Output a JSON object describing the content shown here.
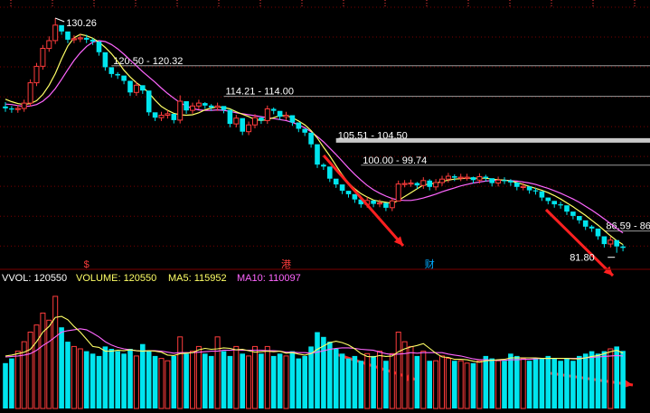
{
  "colors": {
    "background": "#000000",
    "up": "#ff3c3c",
    "down": "#00e5ee",
    "ma5": "#ffff66",
    "ma10": "#ff66ff",
    "grid": "#7a0000",
    "level": "#ffffff",
    "arrow": "#ff2020",
    "label": "#ffffff"
  },
  "chart_data": [
    {
      "type": "candlestick",
      "title": "",
      "ylim": [
        79.5,
        132.5
      ],
      "grid": true,
      "annotations": {
        "high_label": "130.26",
        "low_label": "81.80",
        "levels": [
          {
            "label": "120.50 - 120.32",
            "value": 120.4
          },
          {
            "label": "114.21 - 114.00",
            "value": 114.1
          },
          {
            "label": "105.51 - 104.50",
            "value": 105.0
          },
          {
            "label": "100.00 - 99.74",
            "value": 99.87
          },
          {
            "label": "86.59 - 86",
            "value": 86.3
          }
        ],
        "markers": [
          "$",
          "港",
          "财"
        ],
        "arrows": 2
      },
      "x": [
        1,
        2,
        3,
        4,
        5,
        6,
        7,
        8,
        9,
        10,
        11,
        12,
        13,
        14,
        15,
        16,
        17,
        18,
        19,
        20,
        21,
        22,
        23,
        24,
        25,
        26,
        27,
        28,
        29,
        30,
        31,
        32,
        33,
        34,
        35,
        36,
        37,
        38,
        39,
        40,
        41,
        42,
        43,
        44,
        45,
        46,
        47,
        48,
        49,
        50,
        51,
        52,
        53,
        54,
        55,
        56,
        57,
        58,
        59,
        60,
        61,
        62,
        63,
        64,
        65,
        66,
        67,
        68,
        69,
        70,
        71,
        72,
        73,
        74,
        75,
        76,
        77,
        78,
        79,
        80,
        81,
        82,
        83,
        84,
        85,
        86,
        87,
        88,
        89,
        90,
        91,
        92,
        93,
        94,
        95,
        96,
        97,
        98,
        99,
        100
      ],
      "open": [
        112.0,
        111.6,
        111.4,
        111.6,
        112.7,
        116.9,
        120.3,
        124.0,
        125.6,
        128.8,
        127.5,
        125.8,
        126.0,
        126.2,
        125.8,
        125.4,
        123.2,
        120.1,
        118.7,
        118.4,
        117.3,
        114.9,
        116.4,
        115.3,
        110.8,
        109.7,
        110.2,
        110.5,
        109.2,
        113.1,
        111.2,
        112.1,
        112.7,
        112.2,
        111.8,
        112.1,
        111.3,
        108.4,
        109.6,
        106.8,
        108.2,
        109.7,
        109.1,
        111.5,
        111.1,
        109.9,
        110.2,
        108.7,
        107.4,
        106.6,
        104.2,
        100.0,
        99.6,
        97.1,
        95.9,
        94.6,
        93.9,
        92.8,
        91.8,
        92.6,
        91.9,
        92.1,
        91.1,
        92.5,
        96.0,
        96.1,
        96.2,
        95.7,
        96.7,
        95.4,
        96.3,
        97.0,
        97.6,
        97.3,
        97.4,
        97.4,
        96.8,
        97.5,
        97.2,
        96.2,
        96.8,
        96.7,
        96.3,
        95.4,
        95.5,
        94.7,
        94.5,
        93.2,
        92.5,
        91.8,
        91.6,
        90.3,
        89.4,
        88.5,
        87.2,
        86.8,
        85.2,
        83.6,
        84.4,
        83.1
      ],
      "close": [
        111.6,
        111.4,
        111.6,
        112.7,
        116.9,
        120.3,
        124.0,
        125.6,
        128.8,
        127.5,
        125.8,
        126.0,
        126.2,
        125.8,
        125.4,
        123.2,
        120.1,
        118.7,
        118.4,
        117.3,
        114.9,
        116.4,
        115.3,
        110.8,
        109.7,
        110.2,
        110.5,
        109.2,
        113.1,
        111.2,
        112.1,
        112.7,
        112.2,
        111.8,
        112.1,
        111.3,
        108.4,
        109.6,
        106.8,
        108.2,
        109.7,
        109.1,
        111.5,
        111.1,
        109.9,
        110.2,
        108.7,
        107.4,
        106.6,
        104.2,
        100.0,
        99.6,
        97.1,
        95.9,
        94.6,
        93.9,
        92.8,
        91.8,
        92.6,
        91.9,
        92.1,
        91.1,
        92.5,
        96.0,
        96.1,
        96.2,
        95.7,
        96.7,
        95.4,
        96.3,
        97.0,
        97.6,
        97.3,
        97.4,
        97.4,
        96.8,
        97.5,
        97.2,
        96.2,
        96.8,
        96.7,
        96.3,
        95.4,
        95.5,
        94.7,
        94.5,
        93.2,
        92.5,
        91.8,
        91.6,
        90.3,
        89.4,
        88.5,
        87.2,
        86.8,
        85.2,
        83.6,
        84.4,
        83.1,
        82.8
      ],
      "high": [
        112.9,
        112.1,
        112.3,
        113.4,
        117.6,
        121.0,
        124.7,
        126.5,
        130.26,
        128.3,
        126.5,
        126.7,
        126.9,
        126.8,
        126.1,
        123.9,
        120.9,
        119.4,
        119.1,
        118.0,
        115.6,
        117.1,
        116.0,
        111.5,
        110.4,
        110.9,
        111.2,
        109.9,
        114.3,
        111.9,
        112.8,
        113.4,
        112.9,
        112.5,
        112.8,
        112.0,
        109.1,
        110.3,
        107.5,
        108.9,
        110.4,
        109.8,
        112.2,
        111.8,
        110.6,
        110.9,
        109.4,
        108.1,
        107.1,
        104.9,
        100.7,
        100.3,
        97.8,
        96.6,
        95.3,
        94.6,
        93.5,
        92.5,
        93.3,
        92.6,
        92.8,
        91.8,
        93.2,
        96.7,
        96.8,
        96.9,
        96.4,
        97.4,
        97.0,
        97.0,
        97.7,
        98.3,
        98.0,
        98.1,
        98.1,
        97.5,
        98.2,
        97.9,
        96.9,
        97.5,
        97.4,
        97.0,
        96.1,
        96.2,
        95.4,
        95.2,
        93.9,
        93.2,
        92.5,
        92.3,
        91.0,
        90.1,
        89.2,
        87.9,
        87.5,
        85.9,
        84.3,
        85.1,
        83.8,
        83.5
      ],
      "low": [
        110.9,
        110.7,
        110.7,
        110.9,
        112.0,
        116.2,
        119.6,
        123.3,
        124.9,
        126.8,
        125.1,
        125.1,
        125.3,
        125.1,
        124.7,
        122.5,
        119.4,
        118.0,
        117.7,
        116.6,
        114.2,
        114.2,
        114.6,
        110.1,
        109.0,
        109.0,
        109.5,
        108.5,
        108.5,
        110.5,
        110.5,
        111.4,
        111.5,
        111.1,
        111.1,
        110.6,
        107.7,
        107.7,
        106.1,
        106.1,
        107.5,
        108.4,
        108.4,
        110.4,
        109.2,
        109.2,
        108.0,
        106.7,
        105.9,
        103.5,
        99.3,
        98.9,
        96.4,
        95.2,
        93.9,
        93.2,
        92.1,
        91.1,
        91.1,
        91.2,
        91.2,
        90.4,
        90.4,
        92.5,
        95.3,
        95.4,
        95.0,
        95.0,
        94.7,
        94.7,
        95.6,
        96.3,
        96.6,
        96.6,
        96.7,
        96.1,
        96.1,
        96.5,
        95.5,
        95.5,
        96.0,
        95.6,
        94.7,
        94.7,
        94.0,
        93.8,
        92.5,
        91.8,
        91.1,
        90.9,
        89.6,
        88.7,
        87.8,
        86.5,
        86.1,
        84.5,
        82.9,
        82.9,
        81.8,
        82.1
      ],
      "ma5": [
        113.5,
        113.0,
        112.6,
        112.4,
        112.6,
        113.2,
        114.5,
        116.4,
        118.8,
        121.8,
        124.5,
        126.2,
        126.9,
        126.6,
        126.1,
        125.3,
        124.2,
        122.9,
        121.3,
        119.5,
        118.1,
        116.9,
        116.0,
        114.8,
        113.3,
        112.0,
        111.2,
        110.6,
        110.3,
        110.2,
        110.3,
        110.7,
        111.3,
        111.7,
        111.9,
        111.8,
        111.5,
        110.9,
        110.4,
        109.9,
        109.3,
        109.1,
        109.3,
        109.7,
        110.1,
        110.1,
        109.7,
        109.0,
        108.2,
        107.0,
        105.5,
        103.6,
        101.8,
        99.8,
        97.9,
        96.2,
        95.0,
        94.0,
        93.3,
        92.7,
        92.4,
        92.2,
        92.0,
        92.6,
        93.4,
        94.2,
        95.0,
        95.8,
        96.0,
        96.2,
        96.5,
        96.8,
        97.0,
        97.1,
        97.2,
        97.2,
        97.2,
        97.2,
        97.0,
        96.9,
        96.8,
        96.6,
        96.3,
        95.9,
        95.5,
        95.1,
        94.7,
        94.2,
        93.6,
        92.9,
        92.1,
        91.3,
        90.4,
        89.5,
        88.5,
        87.5,
        86.4,
        85.3,
        84.3,
        83.5
      ],
      "ma10": [
        112.5,
        112.4,
        112.2,
        112.0,
        112.1,
        112.4,
        113.1,
        114.2,
        115.7,
        117.6,
        119.6,
        121.5,
        123.1,
        124.4,
        125.3,
        125.6,
        125.4,
        124.8,
        123.9,
        122.8,
        121.6,
        120.4,
        119.2,
        118.1,
        117.0,
        115.8,
        114.7,
        113.7,
        112.8,
        112.1,
        111.6,
        111.3,
        111.2,
        111.2,
        111.3,
        111.2,
        111.0,
        110.7,
        110.5,
        110.3,
        110.1,
        109.9,
        109.7,
        109.5,
        109.3,
        109.1,
        108.7,
        108.2,
        107.6,
        106.8,
        105.8,
        104.7,
        103.4,
        102.1,
        100.7,
        99.3,
        98.0,
        96.8,
        95.7,
        94.8,
        94.1,
        93.5,
        93.0,
        92.7,
        92.6,
        92.6,
        92.8,
        93.1,
        93.5,
        93.9,
        94.4,
        94.8,
        95.2,
        95.6,
        95.9,
        96.2,
        96.4,
        96.6,
        96.7,
        96.8,
        96.8,
        96.7,
        96.6,
        96.4,
        96.2,
        95.9,
        95.5,
        95.1,
        94.6,
        94.1,
        93.5,
        92.9,
        92.2,
        91.4,
        90.6,
        89.7,
        88.8,
        87.8,
        86.8,
        85.9
      ]
    },
    {
      "type": "bar",
      "title": "",
      "header": {
        "vol": "VVOL: 120550",
        "volume": "VOLUME: 120550",
        "ma5": "MA5: 115952",
        "ma10": "MA10: 110097"
      },
      "ylim": [
        0,
        250000
      ],
      "x": [
        1,
        2,
        3,
        4,
        5,
        6,
        7,
        8,
        9,
        10,
        11,
        12,
        13,
        14,
        15,
        16,
        17,
        18,
        19,
        20,
        21,
        22,
        23,
        24,
        25,
        26,
        27,
        28,
        29,
        30,
        31,
        32,
        33,
        34,
        35,
        36,
        37,
        38,
        39,
        40,
        41,
        42,
        43,
        44,
        45,
        46,
        47,
        48,
        49,
        50,
        51,
        52,
        53,
        54,
        55,
        56,
        57,
        58,
        59,
        60,
        61,
        62,
        63,
        64,
        65,
        66,
        67,
        68,
        69,
        70,
        71,
        72,
        73,
        74,
        75,
        76,
        77,
        78,
        79,
        80,
        81,
        82,
        83,
        84,
        85,
        86,
        87,
        88,
        89,
        90,
        91,
        92,
        93,
        94,
        95,
        96,
        97,
        98,
        99,
        100
      ],
      "values": [
        95000,
        105000,
        120000,
        140000,
        160000,
        175000,
        200000,
        185000,
        235000,
        170000,
        140000,
        130000,
        125000,
        120000,
        115000,
        110000,
        130000,
        125000,
        120000,
        115000,
        125000,
        110000,
        135000,
        120000,
        110000,
        105000,
        100000,
        110000,
        150000,
        115000,
        120000,
        130000,
        115000,
        110000,
        150000,
        120000,
        110000,
        130000,
        115000,
        110000,
        130000,
        115000,
        130000,
        110000,
        115000,
        110000,
        120000,
        105000,
        110000,
        130000,
        160000,
        150000,
        140000,
        125000,
        115000,
        105000,
        110000,
        100000,
        115000,
        110000,
        120000,
        100000,
        115000,
        160000,
        140000,
        130000,
        110000,
        120000,
        100000,
        100000,
        110000,
        105000,
        100000,
        100000,
        95000,
        95000,
        100000,
        110000,
        105000,
        100000,
        100000,
        115000,
        110000,
        105000,
        100000,
        105000,
        105000,
        110000,
        105000,
        100000,
        105000,
        100000,
        110000,
        115000,
        120000,
        115000,
        120000,
        125000,
        130000,
        120550
      ],
      "ma5": [
        110000,
        112000,
        115000,
        118000,
        124000,
        140000,
        160000,
        172000,
        191000,
        193000,
        186000,
        172000,
        160000,
        145000,
        130000,
        128000,
        120000,
        120000,
        122000,
        121000,
        123000,
        121000,
        120000,
        121000,
        120000,
        118000,
        112000,
        111000,
        115000,
        116000,
        117000,
        123000,
        126000,
        124000,
        125000,
        127000,
        126000,
        123000,
        124000,
        121000,
        118000,
        119000,
        120000,
        119000,
        120000,
        116000,
        117000,
        114000,
        112000,
        115000,
        124000,
        131000,
        138000,
        141000,
        138000,
        133000,
        125000,
        115000,
        109000,
        108000,
        111000,
        109000,
        110000,
        119000,
        125000,
        129000,
        132000,
        136000,
        126000,
        116000,
        108000,
        107000,
        103000,
        103000,
        102000,
        99000,
        97000,
        100000,
        101000,
        102000,
        103000,
        106000,
        106000,
        106000,
        106000,
        106000,
        105000,
        105000,
        105000,
        105000,
        105000,
        104000,
        104000,
        106000,
        109000,
        111000,
        115000,
        119000,
        122000,
        115952
      ],
      "ma10": [
        108000,
        109000,
        110000,
        112000,
        115000,
        122000,
        132000,
        140000,
        150000,
        160000,
        163000,
        165000,
        167000,
        165000,
        158000,
        150000,
        140000,
        133000,
        128000,
        125000,
        123000,
        121000,
        120000,
        121000,
        121000,
        120000,
        118000,
        116000,
        117000,
        117000,
        117000,
        118000,
        119000,
        120000,
        120000,
        122000,
        122000,
        123000,
        122000,
        122000,
        122000,
        122000,
        121000,
        121000,
        120000,
        118000,
        118000,
        117000,
        117000,
        116000,
        118000,
        121000,
        124000,
        126000,
        127000,
        127000,
        126000,
        124000,
        123000,
        122000,
        118000,
        115000,
        113000,
        114000,
        115000,
        117000,
        116000,
        117000,
        117000,
        117000,
        117000,
        114000,
        112000,
        110000,
        107000,
        104000,
        102000,
        102000,
        101000,
        101000,
        101000,
        102000,
        102000,
        103000,
        103000,
        104000,
        105000,
        105000,
        105000,
        105000,
        105000,
        105000,
        105000,
        106000,
        107000,
        108000,
        109000,
        110000,
        111000,
        110097
      ]
    }
  ]
}
